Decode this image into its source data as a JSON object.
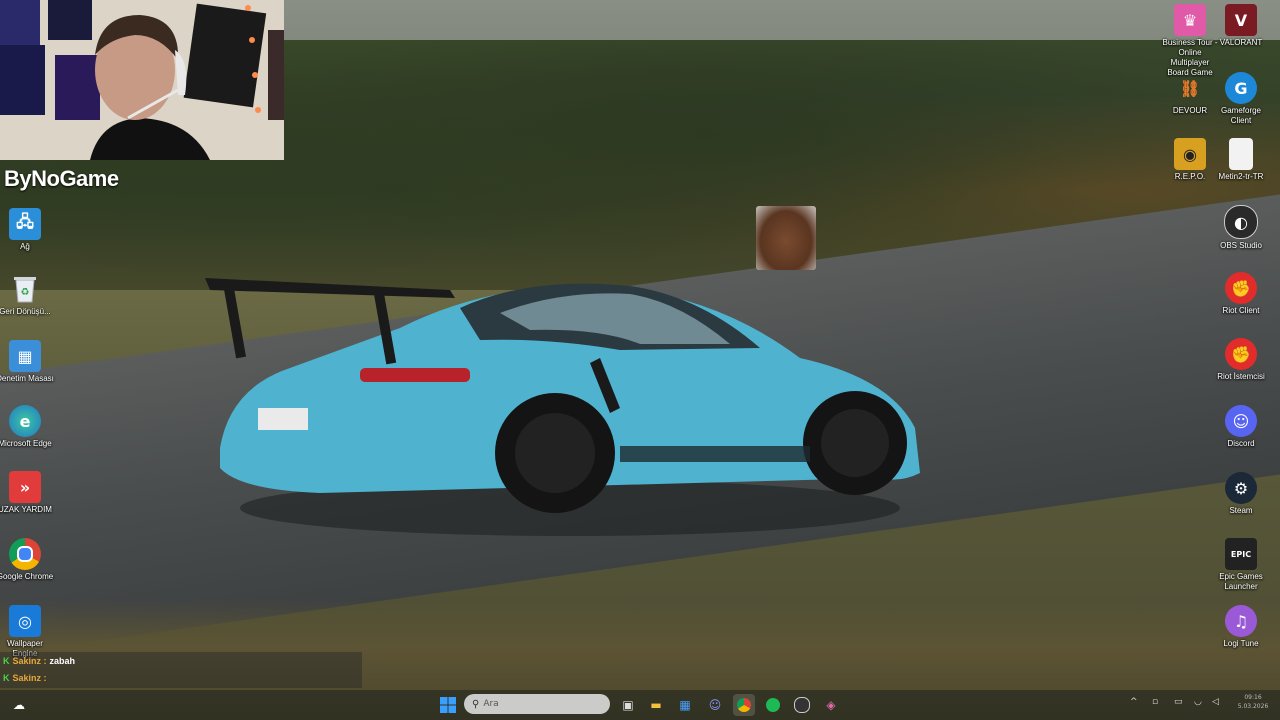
{
  "overlay": {
    "channel_name": "ByNoGame",
    "meme_emote": "laughing-man-emote"
  },
  "desktop_left": [
    {
      "label": "Ağ",
      "icon": "network-icon",
      "color": "#2a8fd8"
    },
    {
      "label": "Geri Dönüşü...",
      "icon": "recycle-bin-icon",
      "color": "#dfe6ec"
    },
    {
      "label": "Denetim Masası",
      "icon": "control-panel-icon",
      "color": "#3b8ed8"
    },
    {
      "label": "Microsoft Edge",
      "icon": "edge-icon",
      "color": "#1e9b6a"
    },
    {
      "label": "UZAK YARDIM",
      "icon": "remote-help-icon",
      "color": "#e23b3b"
    },
    {
      "label": "Google Chrome",
      "icon": "chrome-icon",
      "color": "#e8e8e8"
    },
    {
      "label": "Wallpaper Engine",
      "icon": "wallpaper-engine-icon",
      "color": "#1a7ad8"
    }
  ],
  "desktop_right": [
    {
      "label": "Business Tour - Online Multiplayer Board Game",
      "icon": "business-tour-icon",
      "color": "#e05aa8"
    },
    {
      "label": "VALORANT",
      "icon": "valorant-icon",
      "color": "#7a1a22"
    },
    {
      "label": "DEVOUR",
      "icon": "devour-icon",
      "color": "#3a2a1a"
    },
    {
      "label": "Gameforge Client",
      "icon": "gameforge-icon",
      "color": "#1e88d8"
    },
    {
      "label": "R.E.P.O.",
      "icon": "repo-icon",
      "color": "#d8a020"
    },
    {
      "label": "Metin2-tr-TR",
      "icon": "file-icon",
      "color": "#f2f2f2"
    },
    {
      "label": "OBS Studio",
      "icon": "obs-icon",
      "color": "#2a2a2a"
    },
    {
      "label": "Riot Client",
      "icon": "riot-icon",
      "color": "#e22b2b"
    },
    {
      "label": "Riot İstemcisi",
      "icon": "riot-client-icon",
      "color": "#e22b2b"
    },
    {
      "label": "Discord",
      "icon": "discord-icon",
      "color": "#5865f2"
    },
    {
      "label": "Steam",
      "icon": "steam-icon",
      "color": "#1b2838"
    },
    {
      "label": "Epic Games Launcher",
      "icon": "epic-games-icon",
      "color": "#222222"
    },
    {
      "label": "Logi Tune",
      "icon": "logi-tune-icon",
      "color": "#9a5ad8"
    }
  ],
  "chat": [
    {
      "badge": "K",
      "user": "Sakinz :",
      "message": "zabah"
    },
    {
      "badge": "K",
      "user": "Sakinz :",
      "message": ""
    }
  ],
  "taskbar": {
    "search_placeholder": "Ara",
    "apps": [
      {
        "name": "start-button",
        "icon": "windows-icon",
        "color": "#3aa0ff"
      },
      {
        "name": "task-view-button",
        "icon": "task-view-icon",
        "color": "#cccccc"
      },
      {
        "name": "file-explorer-button",
        "icon": "folder-icon",
        "color": "#f2c23a"
      },
      {
        "name": "store-button",
        "icon": "store-icon",
        "color": "#2a7ad8"
      },
      {
        "name": "discord-taskbar-button",
        "icon": "discord-icon",
        "color": "#5865f2"
      },
      {
        "name": "chrome-taskbar-button",
        "icon": "chrome-icon",
        "color": "#e8e8e8"
      },
      {
        "name": "spotify-button",
        "icon": "spotify-icon",
        "color": "#1db954"
      },
      {
        "name": "obs-taskbar-button",
        "icon": "obs-icon",
        "color": "#333333"
      },
      {
        "name": "extra-app-button",
        "icon": "app-icon",
        "color": "#c04a8a"
      }
    ],
    "clock_time": "09:16",
    "clock_date": "5.03.2026"
  }
}
